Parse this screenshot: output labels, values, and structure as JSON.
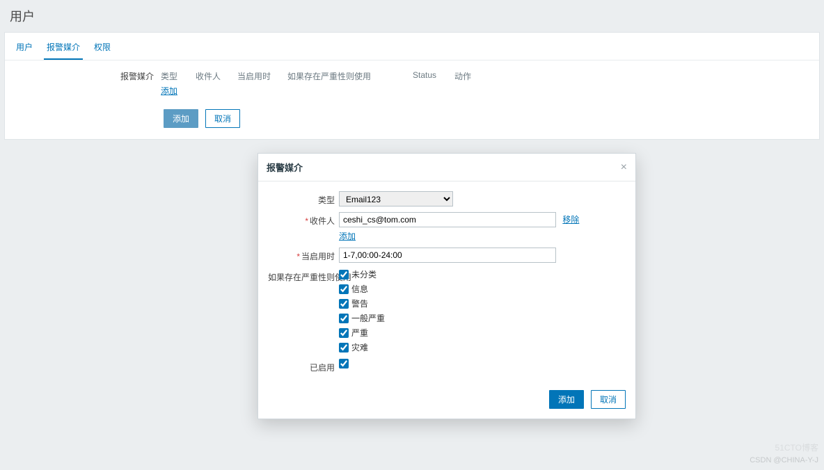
{
  "page": {
    "title": "用户"
  },
  "tabs": {
    "user": "用户",
    "media": "报警媒介",
    "perm": "权限"
  },
  "table": {
    "section_label": "报警媒介",
    "headers": {
      "type": "类型",
      "recipient": "收件人",
      "when": "当启用时",
      "severity": "如果存在严重性则使用",
      "status": "Status",
      "action": "动作"
    },
    "add_link": "添加"
  },
  "buttons": {
    "add": "添加",
    "cancel": "取消"
  },
  "modal": {
    "title": "报警媒介",
    "labels": {
      "type": "类型",
      "recipient": "收件人",
      "when": "当启用时",
      "severity": "如果存在严重性则使用",
      "enabled": "已启用"
    },
    "type_value": "Email123",
    "recipient_value": "ceshi_cs@tom.com",
    "remove": "移除",
    "add_recipient": "添加",
    "when_value": "1-7,00:00-24:00",
    "severities": {
      "s0": "未分类",
      "s1": "信息",
      "s2": "警告",
      "s3": "一般严重",
      "s4": "严重",
      "s5": "灾难"
    },
    "enabled_checked": true,
    "btn_add": "添加",
    "btn_cancel": "取消"
  },
  "watermark": {
    "top": "51CTO博客",
    "bottom": "CSDN @CHINA-Y-J"
  }
}
